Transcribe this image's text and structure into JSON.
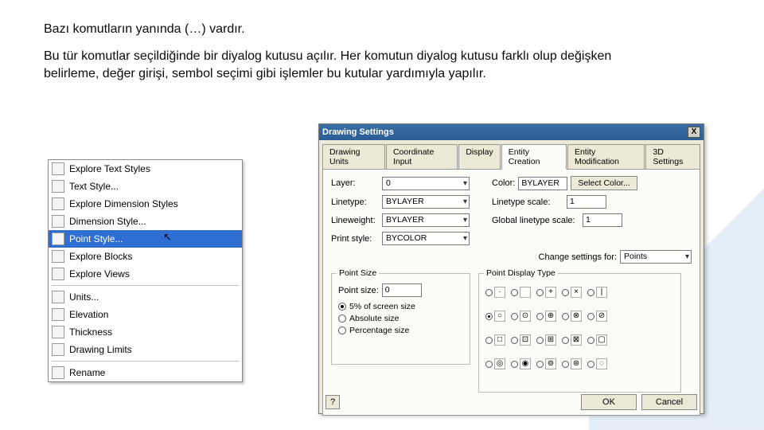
{
  "slide": {
    "p1": "Bazı komutların yanında (…) vardır.",
    "p2": "Bu tür komutlar seçildiğinde bir diyalog kutusu açılır. Her komutun diyalog kutusu farklı olup değişken belirleme, değer girişi, sembol seçimi gibi işlemler bu kutular yardımıyla yapılır."
  },
  "menu": {
    "items": [
      {
        "label": "Explore Text Styles"
      },
      {
        "label": "Text Style..."
      },
      {
        "label": "Explore Dimension Styles"
      },
      {
        "label": "Dimension Style..."
      },
      {
        "label": "Point Style...",
        "selected": true
      },
      {
        "label": "Explore Blocks"
      },
      {
        "label": "Explore Views"
      }
    ],
    "items2": [
      {
        "label": "Units..."
      },
      {
        "label": "Elevation"
      },
      {
        "label": "Thickness"
      },
      {
        "label": "Drawing Limits"
      }
    ],
    "items3": [
      {
        "label": "Rename"
      }
    ]
  },
  "dialog": {
    "title": "Drawing Settings",
    "close": "X",
    "tabs": [
      "Drawing Units",
      "Coordinate Input",
      "Display",
      "Entity Creation",
      "Entity Modification",
      "3D Settings"
    ],
    "activeTab": 3,
    "layer_lbl": "Layer:",
    "layer_val": "0",
    "color_lbl": "Color:",
    "color_val": "BYLAYER",
    "selcolor": "Select Color...",
    "linetype_lbl": "Linetype:",
    "linetype_val": "BYLAYER",
    "ltscale_lbl": "Linetype scale:",
    "ltscale_val": "1",
    "linewt_lbl": "Lineweight:",
    "linewt_val": "BYLAYER",
    "gltscale_lbl": "Global linetype scale:",
    "gltscale_val": "1",
    "printsty_lbl": "Print style:",
    "printsty_val": "BYCOLOR",
    "chg_lbl": "Change settings for:",
    "chg_val": "Points",
    "gb1_title": "Point Size",
    "ptsz_lbl": "Point size:",
    "ptsz_val": "0",
    "r1": "5% of screen size",
    "r2": "Absolute size",
    "r3": "Percentage size",
    "gb2_title": "Point Display Type",
    "symbols": [
      "·",
      " ",
      "+",
      "×",
      "|",
      "○",
      "⊙",
      "⊕",
      "⊗",
      "⊘",
      "□",
      "⊡",
      "⊞",
      "⊠",
      "▢",
      "◎",
      "◉",
      "⊚",
      "⊛",
      "◌"
    ],
    "help": "?",
    "ok": "OK",
    "cancel": "Cancel"
  }
}
